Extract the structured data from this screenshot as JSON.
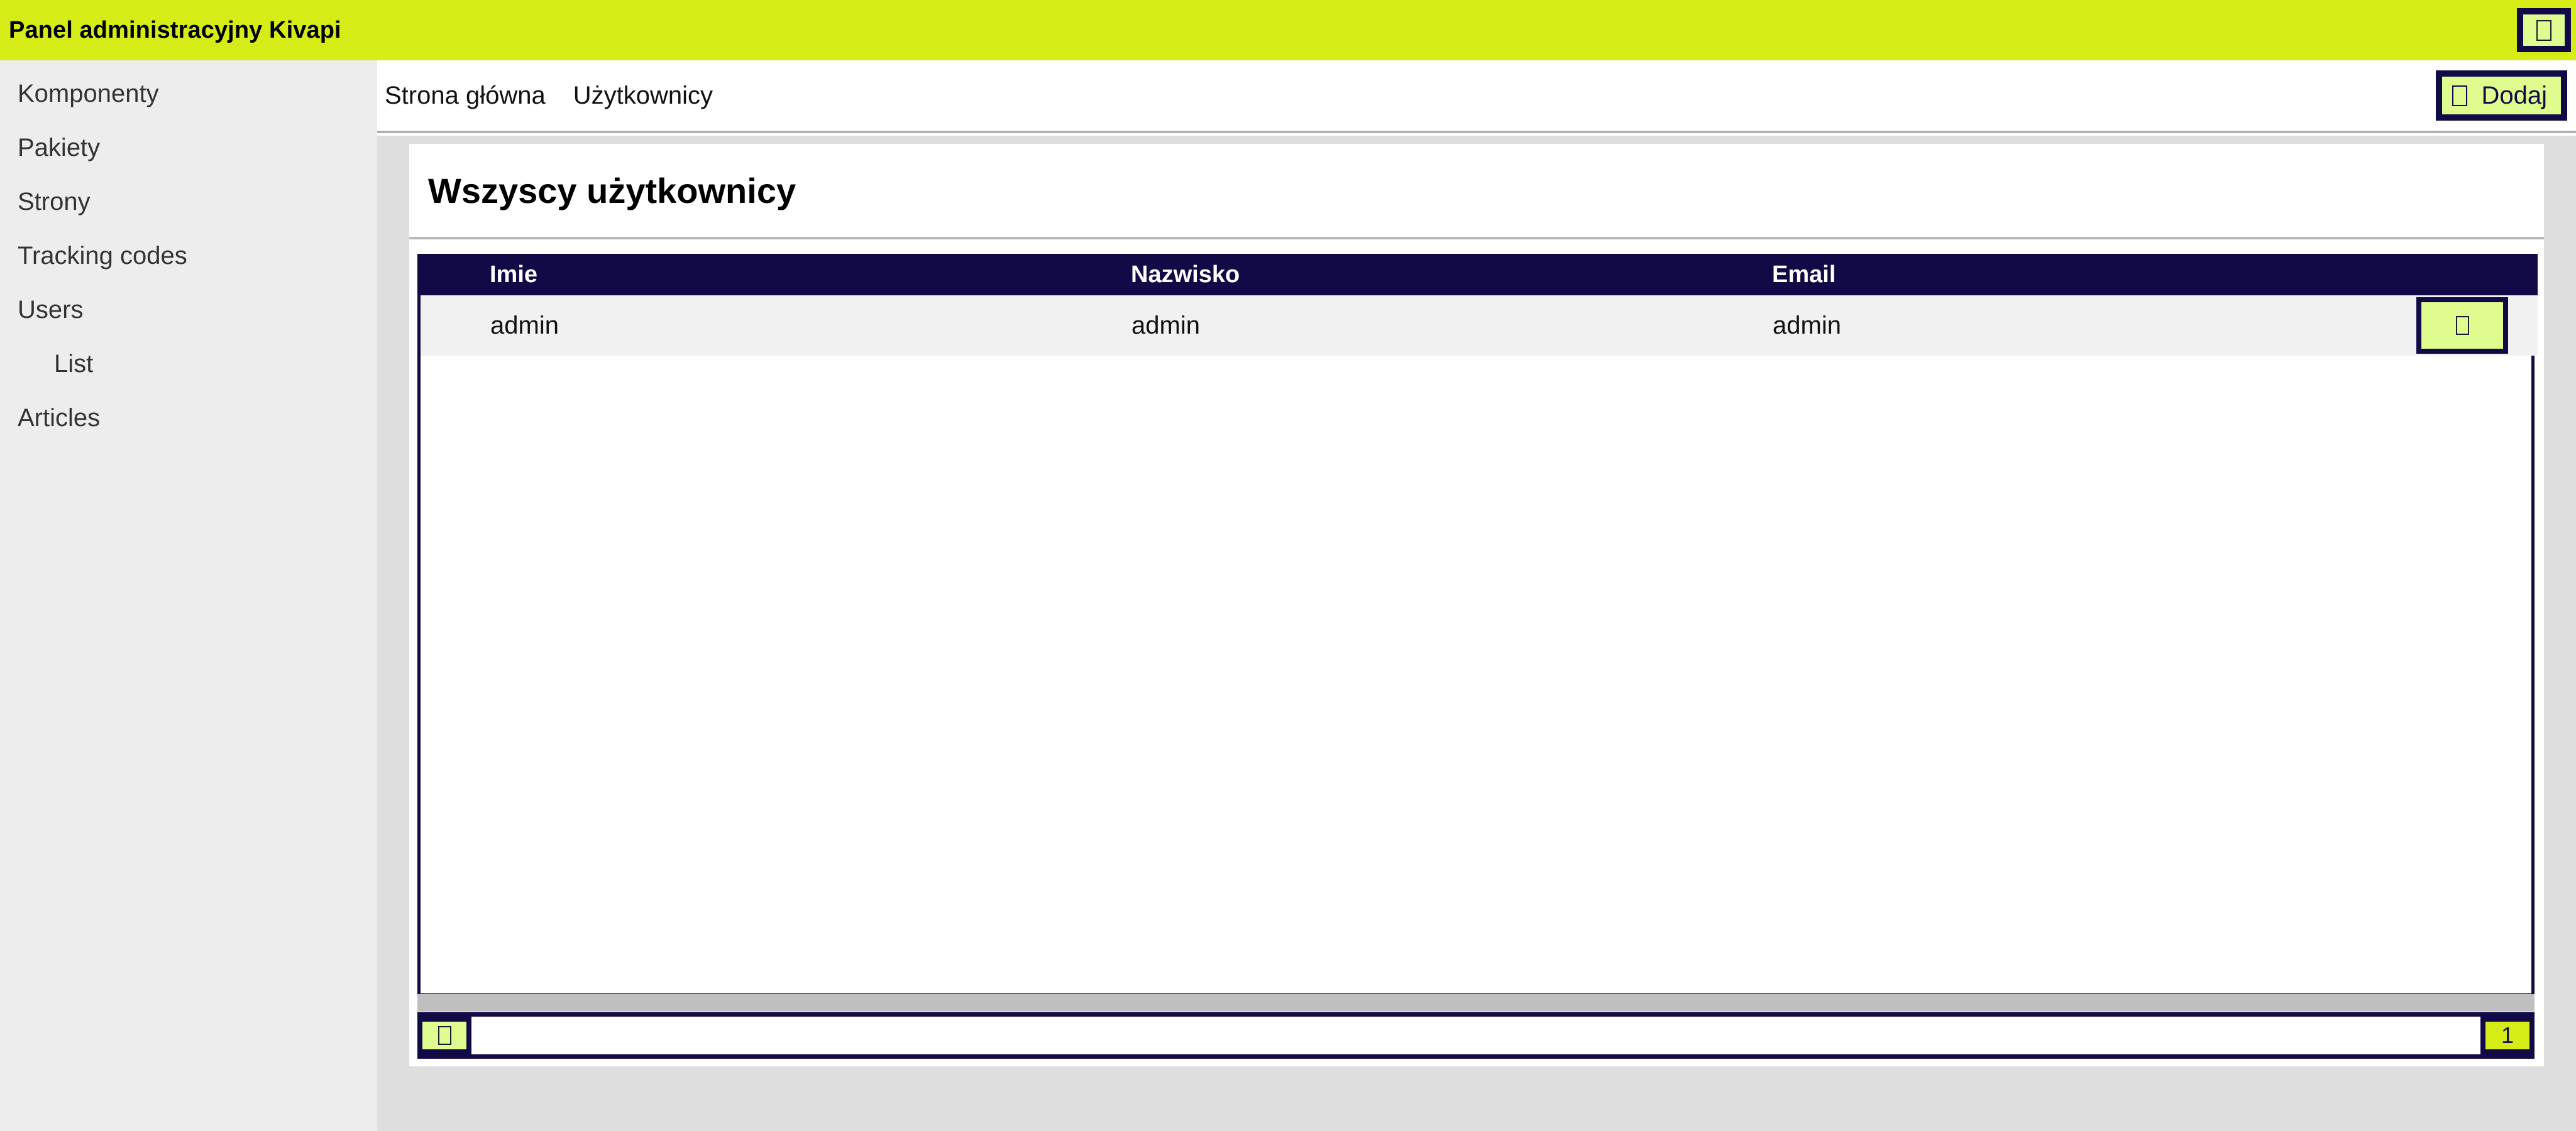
{
  "app": {
    "title": "Panel administracyjny Kivapi",
    "header_bg": "#d5ec16",
    "accent_dark": "#120a47",
    "accent_light": "#defd8e",
    "toggle_icon": "menu-toggle-icon"
  },
  "sidebar": {
    "items": [
      {
        "label": "Komponenty",
        "sub": false
      },
      {
        "label": "Pakiety",
        "sub": false
      },
      {
        "label": "Strony",
        "sub": false
      },
      {
        "label": "Tracking codes",
        "sub": false
      },
      {
        "label": "Users",
        "sub": false
      },
      {
        "label": "List",
        "sub": true
      },
      {
        "label": "Articles",
        "sub": false
      }
    ]
  },
  "breadcrumb": {
    "items": [
      {
        "label": "Strona główna"
      },
      {
        "label": "Użytkownicy"
      }
    ]
  },
  "toolbar": {
    "add_label": "Dodaj",
    "add_icon": "plus-icon"
  },
  "card": {
    "title": "Wszyscy użytkownicy"
  },
  "table": {
    "columns": [
      "",
      "Imie",
      "Nazwisko",
      "Email",
      ""
    ],
    "rows": [
      {
        "imie": "admin",
        "nazwisko": "admin",
        "email": "admin",
        "action_icon": "edit-icon"
      }
    ]
  },
  "pagination": {
    "prev_icon": "chevron-left-icon",
    "current_page": "1"
  }
}
